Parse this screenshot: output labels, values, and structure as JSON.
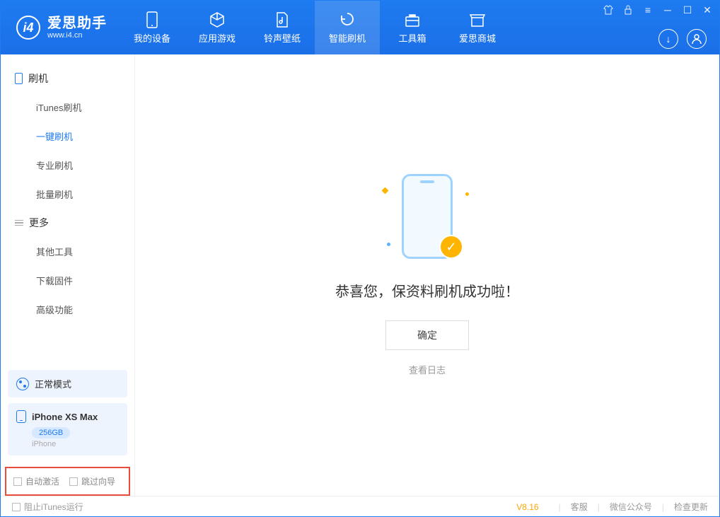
{
  "app": {
    "name_cn": "爱思助手",
    "name_en": "www.i4.cn"
  },
  "header_tabs": [
    {
      "label": "我的设备"
    },
    {
      "label": "应用游戏"
    },
    {
      "label": "铃声壁纸"
    },
    {
      "label": "智能刷机"
    },
    {
      "label": "工具箱"
    },
    {
      "label": "爱思商城"
    }
  ],
  "sidebar": {
    "group1": "刷机",
    "items1": [
      "iTunes刷机",
      "一键刷机",
      "专业刷机",
      "批量刷机"
    ],
    "group2": "更多",
    "items2": [
      "其他工具",
      "下载固件",
      "高级功能"
    ]
  },
  "device": {
    "mode": "正常模式",
    "name": "iPhone XS Max",
    "capacity": "256GB",
    "type": "iPhone"
  },
  "checkboxes": {
    "auto_activate": "自动激活",
    "skip_guide": "跳过向导"
  },
  "main": {
    "success_msg": "恭喜您，保资料刷机成功啦！",
    "ok": "确定",
    "view_log": "查看日志"
  },
  "footer": {
    "prevent_itunes": "阻止iTunes运行",
    "version": "V8.16",
    "support": "客服",
    "wechat": "微信公众号",
    "check_update": "检查更新"
  }
}
